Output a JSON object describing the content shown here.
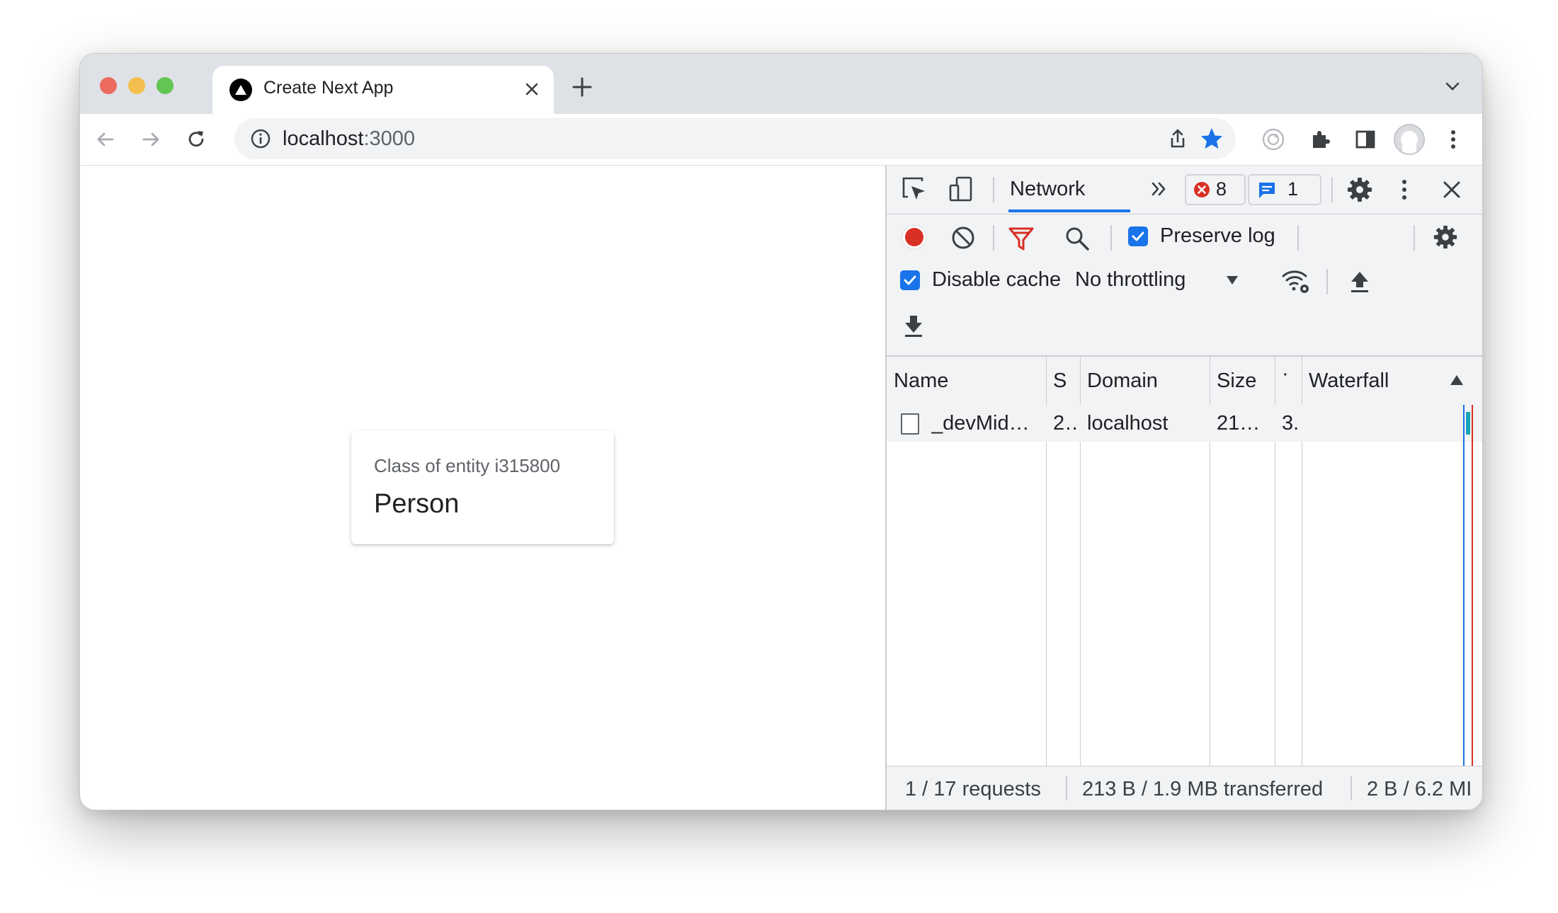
{
  "browser": {
    "tab_title": "Create Next App",
    "url_host": "localhost",
    "url_port": ":3000"
  },
  "page": {
    "card_caption": "Class of entity i315800",
    "card_value": "Person"
  },
  "devtools": {
    "active_tab": "Network",
    "error_count": "8",
    "message_count": "1",
    "preserve_log_label": "Preserve log",
    "preserve_log_checked": true,
    "disable_cache_label": "Disable cache",
    "disable_cache_checked": true,
    "throttling_value": "No throttling",
    "columns": [
      "Name",
      "S",
      "Domain",
      "Size",
      "·",
      "Waterfall"
    ],
    "rows": [
      {
        "name": "_devMid…",
        "status": "2…",
        "domain": "localhost",
        "size": "21…",
        "time": "3."
      }
    ],
    "status": {
      "requests": "1 / 17 requests",
      "transferred": "213 B / 1.9 MB transferred",
      "resources": "2 B / 6.2 MI"
    }
  },
  "colors": {
    "accent": "#1a73e8",
    "record": "#d93025",
    "traffic_close": "#ed6a5e",
    "traffic_min": "#f5bf4f",
    "traffic_max": "#62c554"
  }
}
